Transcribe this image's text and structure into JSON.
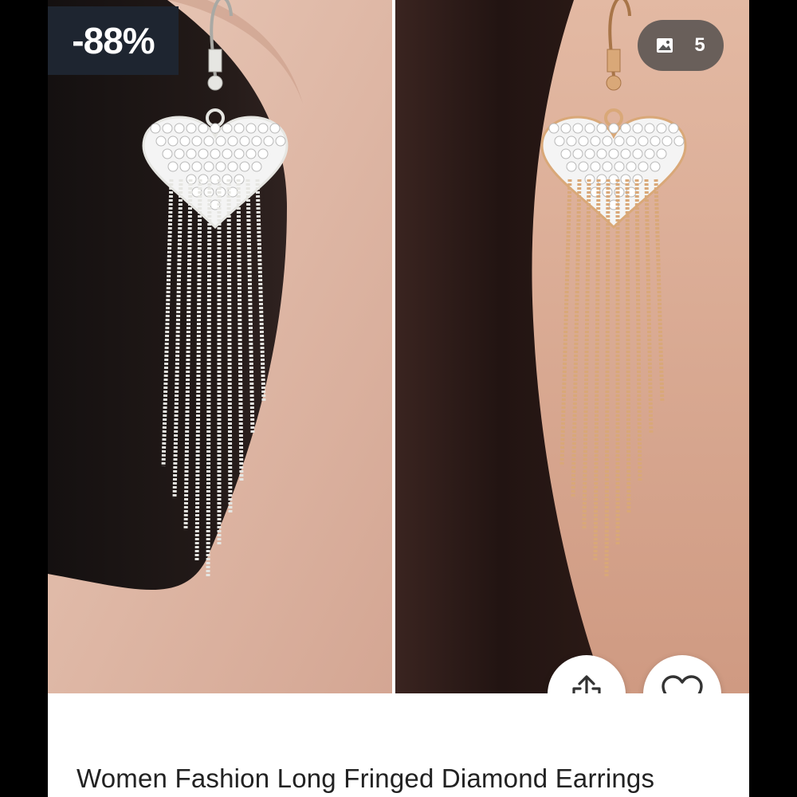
{
  "product": {
    "discount_badge": "-88%",
    "photo_count": "5",
    "title": "Women Fashion Long Fringed Diamond Earrings",
    "image_alt": "Heart shaped rhinestone earrings with long chain fringe, silver and gold"
  },
  "icons": {
    "photos": "image-icon",
    "share": "share-icon",
    "favorite": "heart-icon"
  },
  "colors": {
    "badge_bg": "#1e2530",
    "silver": "#e6e6e2",
    "gold": "#d9a878"
  }
}
